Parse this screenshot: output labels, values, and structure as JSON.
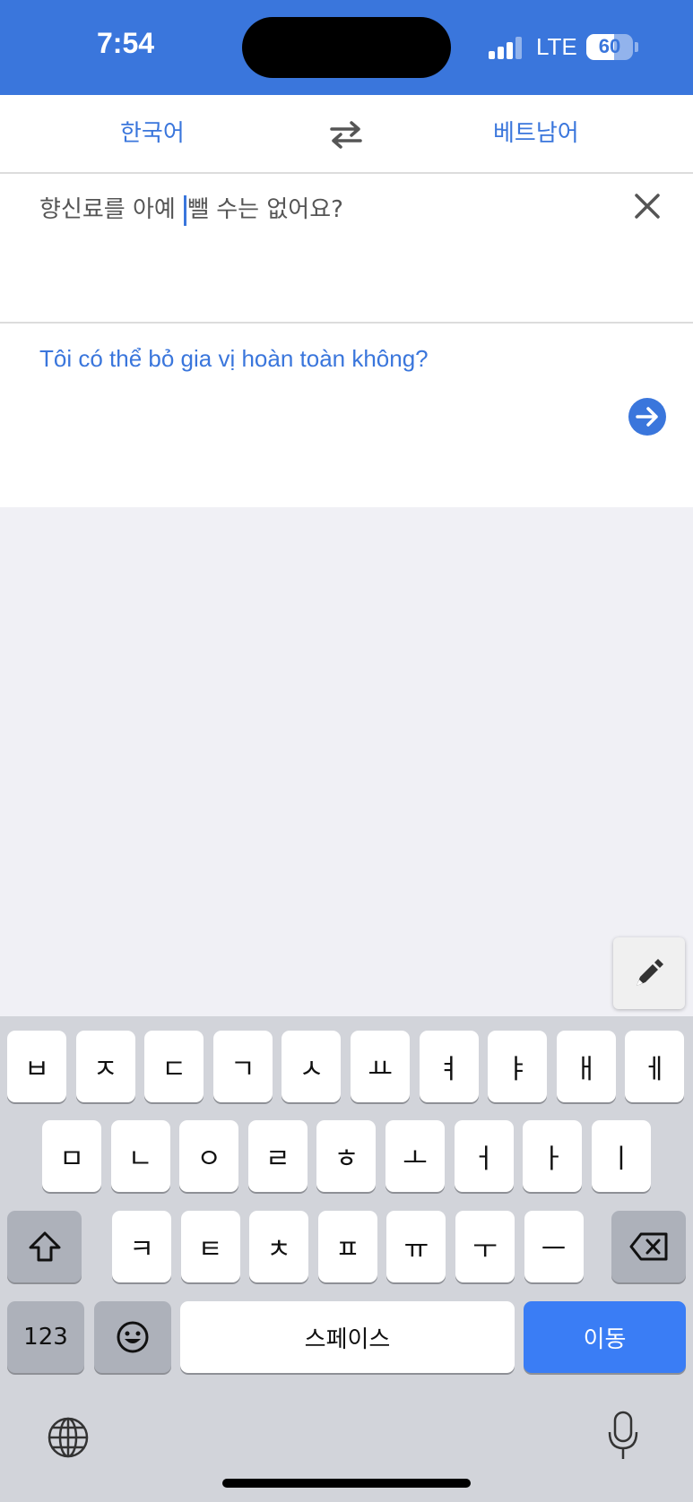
{
  "status_bar": {
    "time": "7:54",
    "network": "LTE",
    "battery": "60",
    "battery_level": 0.6,
    "signal_bars": 3
  },
  "lang_bar": {
    "source": "한국어",
    "target": "베트남어",
    "swap_icon": "swap-arrows-icon"
  },
  "input": {
    "text_before_caret": "향신료를 아예 ",
    "text_after_caret": "뺄 수는 없어요?",
    "clear_icon": "close-icon"
  },
  "output": {
    "text": "Tôi có thể bỏ gia vị hoàn toàn không?",
    "go_icon": "arrow-right-icon"
  },
  "handwriting_icon": "pen-icon",
  "keyboard": {
    "row1": [
      "ㅂ",
      "ㅈ",
      "ㄷ",
      "ㄱ",
      "ㅅ",
      "ㅛ",
      "ㅕ",
      "ㅑ",
      "ㅐ",
      "ㅔ"
    ],
    "row2": [
      "ㅁ",
      "ㄴ",
      "ㅇ",
      "ㄹ",
      "ㅎ",
      "ㅗ",
      "ㅓ",
      "ㅏ",
      "ㅣ"
    ],
    "row3": [
      "ㅋ",
      "ㅌ",
      "ㅊ",
      "ㅍ",
      "ㅠ",
      "ㅜ",
      "ㅡ"
    ],
    "numbers_label": "123",
    "space_label": "스페이스",
    "return_label": "이동",
    "shift_icon": "shift-icon",
    "delete_icon": "backspace-icon",
    "emoji_icon": "emoji-icon",
    "globe_icon": "globe-icon",
    "mic_icon": "microphone-icon"
  },
  "colors": {
    "accent": "#3a76dc",
    "key_blue": "#3a7df5",
    "keyboard_bg": "#d2d4da",
    "page_bg": "#f0f0f5"
  }
}
